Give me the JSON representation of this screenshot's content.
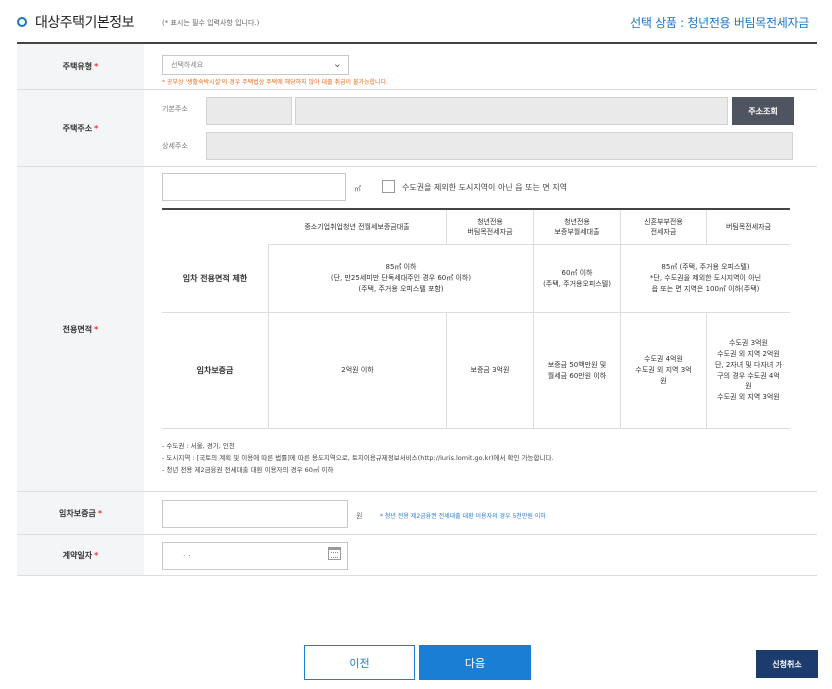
{
  "header": {
    "title": "대상주택기본정보",
    "required_note": "(* 표시는 필수 입력사항 입니다.)",
    "product": "선택 상품 : 청년전용 버팀목전세자금"
  },
  "house_type": {
    "label": "주택유형",
    "select_placeholder": "선택하세요",
    "warning": "* 공부상 '생활숙박시설'의 경우 주택법상 주택에 해당하지 않아 대출 취급이 불가능합니다."
  },
  "address": {
    "label": "주택주소",
    "basic_label": "기본주소",
    "detail_label": "상세주소",
    "search_button": "주소조회"
  },
  "area": {
    "label": "전용면적",
    "unit": "㎡",
    "checkbox_label": "수도권을 제외한 도시지역이 아닌 읍 또는 면 지역",
    "limits": {
      "columns": [
        "중소기업취업청년\n전월세보증금대출",
        "청년전용\n버팀목전세자금",
        "청년전용\n보증부월세대출",
        "신혼부부전용\n전세자금",
        "버팀목전세자금"
      ],
      "area_row": {
        "label": "임차 전용면적 제한",
        "merged_1_2": "85㎡ 이하\n(단, 만25세미만 단독세대주인 경우 60㎡ 이하)\n(주택, 주거용 오피스텔 포함)",
        "col3": "60㎡ 이하\n(주택, 주거용오피스텔)",
        "merged_4_5": "85㎡ (주택, 주거용 오피스텔)\n*단, 수도권을 제외한 도시지역이 아닌\n읍 또는 면 지역은 100㎡ 이하(주택)"
      },
      "deposit_row": {
        "label": "임차보증금",
        "col1": "2억원 이하",
        "col2": "보증금 3억원",
        "col3": "보증금 50백만원 및\n월세금 60만원 이하",
        "col4": "수도권 4억원\n수도권 외 지역 3억\n원",
        "col5": "수도권 3억원\n수도권 외 지역 2억원\n단, 2자녀 및 다자녀 가\n구의 경우 수도권 4억\n원\n수도권 외 지역 3억원"
      }
    },
    "notes": [
      "- 수도권 : 서울, 경기, 인천",
      "- 도시지역 : [국토의 계획 및 이용에 따른 법률]에 따른 용도지역으로, 토지이용규제정보서비스(http://luris.lomit.go.kr)에서 확인 가능합니다.",
      "- 청년 전용 제2금융권 전세대출 대환 이용자의 경우 60㎡ 이하"
    ]
  },
  "deposit": {
    "label": "임차보증금",
    "unit": "원",
    "hint": "* 청년 전용 제2금융권 전세대출 대환 이용자의 경우 5천만원 이하"
  },
  "contract_date": {
    "label": "계약일자",
    "value": ". ."
  },
  "buttons": {
    "prev": "이전",
    "next": "다음",
    "cancel": "신청취소"
  },
  "colors": {
    "accent": "#1a7fd4",
    "required": "#e33333",
    "warning": "#e86a1a",
    "cancel_bg": "#1d3c6e"
  }
}
